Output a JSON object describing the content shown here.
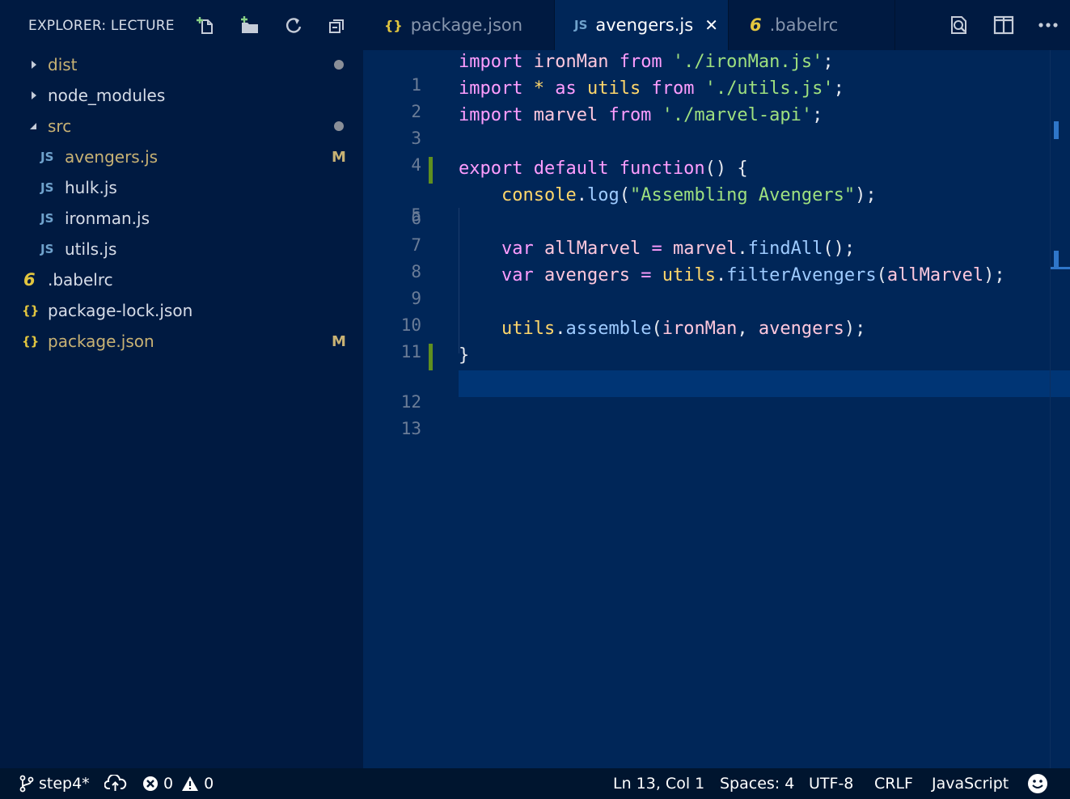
{
  "sidebar": {
    "title": "EXPLORER: LECTURE",
    "actions": [
      "new-file-icon",
      "new-folder-icon",
      "refresh-icon",
      "collapse-all-icon"
    ],
    "items": [
      {
        "label": "dist",
        "kind": "folder",
        "expanded": false,
        "dot": true,
        "badge": ""
      },
      {
        "label": "node_modules",
        "kind": "folder",
        "expanded": false,
        "dot": false,
        "badge": ""
      },
      {
        "label": "src",
        "kind": "folder",
        "expanded": true,
        "dot": true,
        "badge": ""
      },
      {
        "label": "avengers.js",
        "kind": "js",
        "icon_text": "JS",
        "badge": "M"
      },
      {
        "label": "hulk.js",
        "kind": "js",
        "icon_text": "JS",
        "badge": ""
      },
      {
        "label": "ironman.js",
        "kind": "js",
        "icon_text": "JS",
        "badge": ""
      },
      {
        "label": "utils.js",
        "kind": "js",
        "icon_text": "JS",
        "badge": ""
      },
      {
        "label": ".babelrc",
        "kind": "babel",
        "icon_text": "6",
        "badge": ""
      },
      {
        "label": "package-lock.json",
        "kind": "json",
        "icon_text": "{}",
        "badge": ""
      },
      {
        "label": "package.json",
        "kind": "json",
        "icon_text": "{}",
        "badge": "M"
      }
    ]
  },
  "tabs": [
    {
      "label": "package.json",
      "icon_text": "{}",
      "active": false
    },
    {
      "label": "avengers.js",
      "icon_text": "JS",
      "active": true,
      "close": "✕"
    },
    {
      "label": ".babelrc",
      "icon_text": "6",
      "active": false
    }
  ],
  "editor_actions": [
    "search-preview-icon",
    "split-editor-icon",
    "more-actions-icon"
  ],
  "editor": {
    "current_line": 13,
    "lines": [
      {
        "n": "1"
      },
      {
        "n": "2"
      },
      {
        "n": "3"
      },
      {
        "n": "4"
      },
      {
        "n": "5"
      },
      {
        "n": "6"
      },
      {
        "n": "7"
      },
      {
        "n": "8"
      },
      {
        "n": "9"
      },
      {
        "n": "10"
      },
      {
        "n": "11"
      },
      {
        "n": "12"
      },
      {
        "n": "13"
      }
    ],
    "code": {
      "l1": [
        "import",
        " ironMan",
        " from",
        " './ironMan.js'",
        ";"
      ],
      "l2": [
        "import",
        " *",
        " as",
        " utils",
        " from",
        " './utils.js'",
        ";"
      ],
      "l3": [
        "import",
        " marvel",
        " from",
        " './marvel-api'",
        ";"
      ],
      "l5": [
        "export",
        " default",
        " function",
        "()",
        " {"
      ],
      "l6": [
        "console",
        ".",
        "log",
        "(",
        "\"Assembling Avengers\"",
        ");"
      ],
      "l8": [
        "var",
        " allMarvel",
        " =",
        " marvel",
        ".",
        "findAll",
        "();"
      ],
      "l9": [
        "var",
        " avengers",
        " =",
        " utils",
        ".",
        "filterAvengers",
        "(",
        "allMarvel",
        ");"
      ],
      "l11": [
        "utils",
        ".",
        "assemble",
        "(",
        "ironMan",
        ",",
        " avengers",
        ");"
      ],
      "l12": [
        "}"
      ]
    }
  },
  "statusbar": {
    "branch": "step4*",
    "errors": "0",
    "warnings": "0",
    "position": "Ln 13, Col 1",
    "spaces": "Spaces: 4",
    "encoding": "UTF-8",
    "eol": "CRLF",
    "language": "JavaScript"
  },
  "colors": {
    "js_icon": "#6fa2cc",
    "json_icon": "#e2c63f",
    "babel_icon": "#e2c63f",
    "modified": "#c8b274",
    "gutter_modified": "#5f8f1f"
  }
}
